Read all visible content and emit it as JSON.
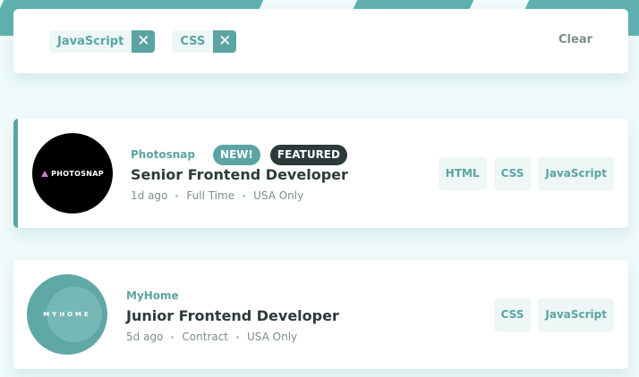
{
  "filters": {
    "active": [
      {
        "label": "JavaScript"
      },
      {
        "label": "CSS"
      }
    ],
    "remove_symbol": "✕",
    "clear_label": "Clear"
  },
  "jobs": [
    {
      "company": "Photosnap",
      "logo_text": "PHOTOSNAP",
      "new_label": "NEW!",
      "featured_label": "FEATURED",
      "position": "Senior Frontend Developer",
      "posted": "1d ago",
      "contract": "Full Time",
      "location": "USA Only",
      "tools": [
        "HTML",
        "CSS",
        "JavaScript"
      ]
    },
    {
      "company": "MyHome",
      "logo_text": "MYHOME",
      "position": "Junior Frontend Developer",
      "posted": "5d ago",
      "contract": "Contract",
      "location": "USA Only",
      "tools": [
        "CSS",
        "JavaScript"
      ]
    }
  ],
  "colors": {
    "primary": "#5BA4A4",
    "background": "#EFFAFA",
    "dark": "#2C3A3A",
    "muted": "#7B8E8E",
    "tag_bg": "#EEF6F6"
  }
}
